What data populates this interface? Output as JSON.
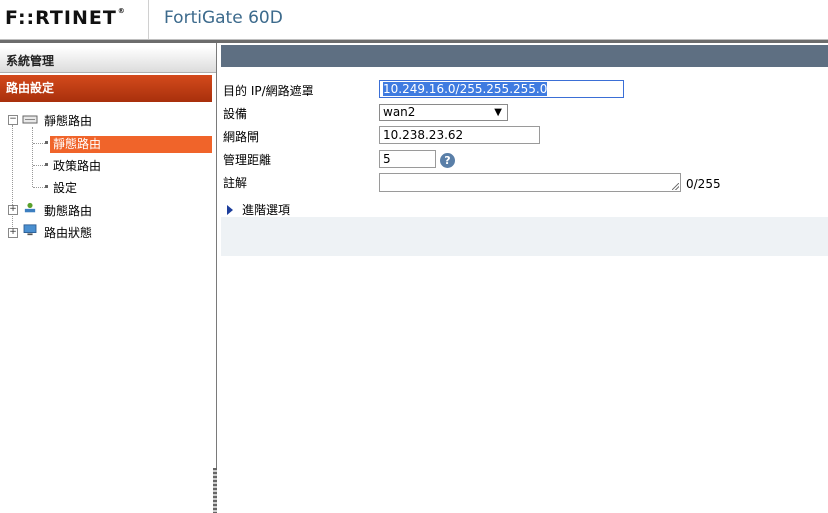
{
  "header": {
    "logo": "F::RTINET",
    "device_name": "FortiGate 60D"
  },
  "sidebar": {
    "section_title": "系統管理",
    "active_section": "路由設定",
    "tree": {
      "static_routing": "靜態路由",
      "static_route": "靜態路由",
      "policy_route": "政策路由",
      "settings": "設定",
      "dynamic_routing": "動態路由",
      "route_status": "路由狀態"
    }
  },
  "form": {
    "destination_label": "目的 IP/網路遮罩",
    "destination_value": "10.249.16.0/255.255.255.0",
    "device_label": "設備",
    "device_value": "wan2",
    "gateway_label": "網路閘",
    "gateway_value": "10.238.23.62",
    "distance_label": "管理距離",
    "distance_value": "5",
    "comment_label": "註解",
    "comment_value": "",
    "comment_counter": "0/255",
    "advanced_label": "進階選項"
  },
  "icons": {
    "help": "help-icon",
    "advanced_toggle": "triangle-right-icon"
  },
  "colors": {
    "active_nav": "#c13b12",
    "selected_leaf": "#f0642a",
    "title_bar": "#5e6f82",
    "help_icon": "#5a7fa8"
  }
}
